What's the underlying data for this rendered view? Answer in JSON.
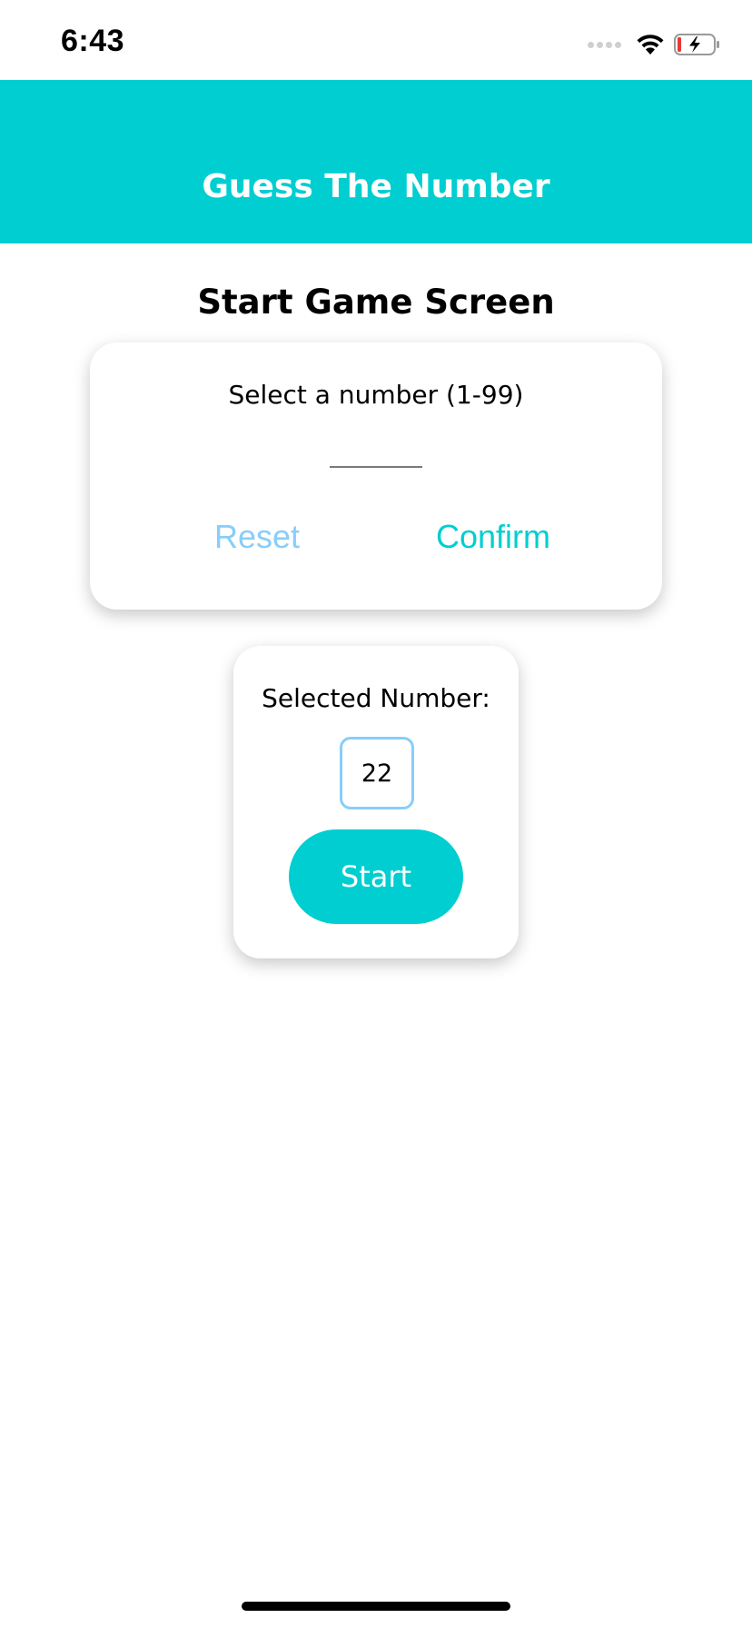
{
  "status_bar": {
    "time": "6:43",
    "icons": [
      "signal-dots-icon",
      "wifi-icon",
      "battery-charging-icon"
    ]
  },
  "header": {
    "title": "Guess The Number"
  },
  "screen": {
    "title": "Start Game Screen"
  },
  "input_card": {
    "label": "Select a number (1-99)",
    "input_value": "",
    "reset_label": "Reset",
    "confirm_label": "Confirm"
  },
  "selected_card": {
    "label": "Selected Number:",
    "number": "22",
    "start_label": "Start"
  },
  "colors": {
    "primary": "#00ced1",
    "accent": "#87cefa",
    "battery_low": "#e53935"
  }
}
